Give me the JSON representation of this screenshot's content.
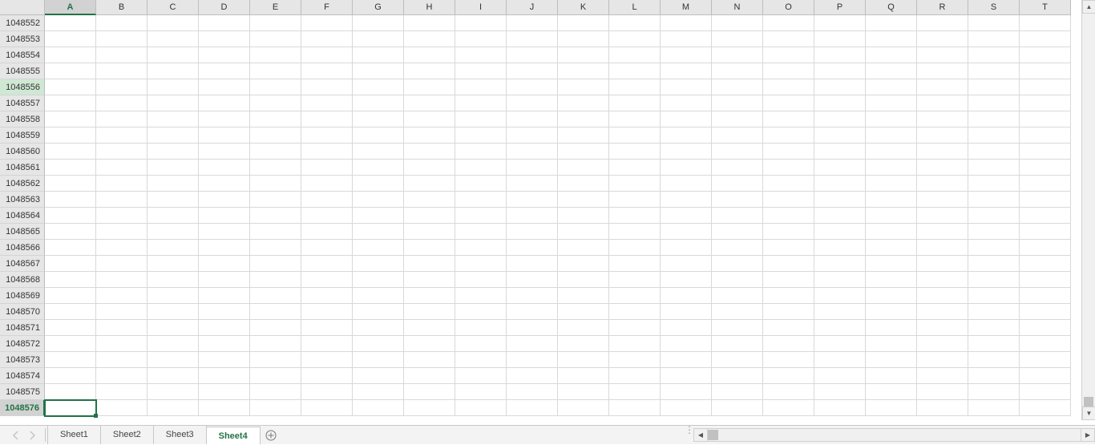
{
  "columns": [
    "A",
    "B",
    "C",
    "D",
    "E",
    "F",
    "G",
    "H",
    "I",
    "J",
    "K",
    "L",
    "M",
    "N",
    "O",
    "P",
    "Q",
    "R",
    "S",
    "T"
  ],
  "selected_column": "A",
  "rows": [
    1048552,
    1048553,
    1048554,
    1048555,
    1048556,
    1048557,
    1048558,
    1048559,
    1048560,
    1048561,
    1048562,
    1048563,
    1048564,
    1048565,
    1048566,
    1048567,
    1048568,
    1048569,
    1048570,
    1048571,
    1048572,
    1048573,
    1048574,
    1048575,
    1048576
  ],
  "selected_row": 1048576,
  "highlight_row": 1048556,
  "tabs": [
    {
      "label": "Sheet1",
      "active": false
    },
    {
      "label": "Sheet2",
      "active": false
    },
    {
      "label": "Sheet3",
      "active": false
    },
    {
      "label": "Sheet4",
      "active": true
    }
  ],
  "icons": {
    "add_sheet": "add-sheet-icon",
    "nav_prev": "tab-nav-prev-icon",
    "nav_next": "tab-nav-next-icon"
  }
}
